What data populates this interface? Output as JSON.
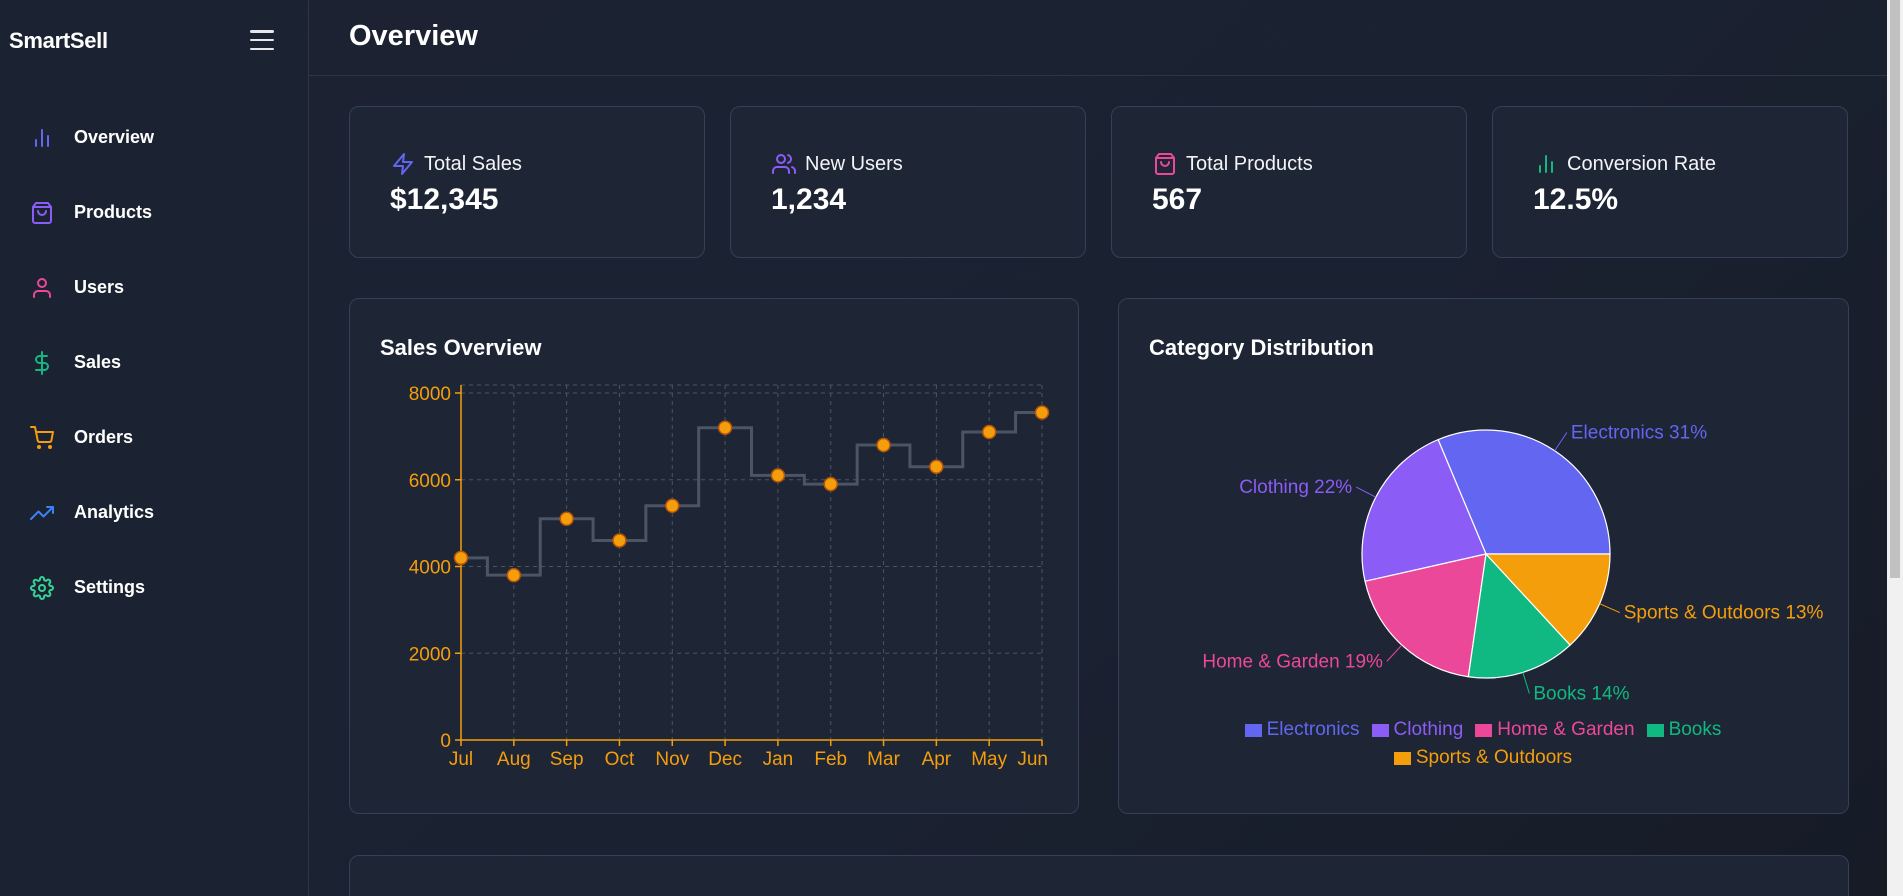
{
  "app": {
    "brand": "SmartSell"
  },
  "header": {
    "title": "Overview"
  },
  "sidebar": {
    "items": [
      {
        "label": "Overview",
        "icon": "bar-chart-icon",
        "color": "#6366f1"
      },
      {
        "label": "Products",
        "icon": "shopping-bag-icon",
        "color": "#8b5cf6"
      },
      {
        "label": "Users",
        "icon": "user-icon",
        "color": "#ec4899"
      },
      {
        "label": "Sales",
        "icon": "dollar-icon",
        "color": "#10b981"
      },
      {
        "label": "Orders",
        "icon": "cart-icon",
        "color": "#f59e0b"
      },
      {
        "label": "Analytics",
        "icon": "trending-up-icon",
        "color": "#3b82f6"
      },
      {
        "label": "Settings",
        "icon": "gear-icon",
        "color": "#34d399"
      }
    ]
  },
  "stats": [
    {
      "label": "Total Sales",
      "value": "$12,345",
      "icon": "zap-icon",
      "color": "#6366f1"
    },
    {
      "label": "New Users",
      "value": "1,234",
      "icon": "users-icon",
      "color": "#8b5cf6"
    },
    {
      "label": "Total Products",
      "value": "567",
      "icon": "shopping-bag-icon",
      "color": "#ec4899"
    },
    {
      "label": "Conversion Rate",
      "value": "12.5%",
      "icon": "bar-chart-icon",
      "color": "#10b981"
    }
  ],
  "sales_chart": {
    "title": "Sales Overview"
  },
  "pie_chart": {
    "title": "Category Distribution"
  },
  "colors": {
    "accent": "#f59e0b",
    "line": "#4b5563",
    "grid": "#4b5563"
  },
  "chart_data": [
    {
      "type": "line",
      "step": true,
      "categories": [
        "Jul",
        "Aug",
        "Sep",
        "Oct",
        "Nov",
        "Dec",
        "Jan",
        "Feb",
        "Mar",
        "Apr",
        "May",
        "Jun"
      ],
      "values": [
        4200,
        3800,
        5100,
        4600,
        5400,
        7200,
        6100,
        5900,
        6800,
        6300,
        7100,
        7550
      ],
      "ylim": [
        0,
        8000
      ],
      "yticks": [
        0,
        2000,
        4000,
        6000,
        8000
      ],
      "grid": true,
      "title": "Sales Overview"
    },
    {
      "type": "pie",
      "title": "Category Distribution",
      "slices": [
        {
          "label": "Electronics",
          "value": 31,
          "color": "#6366f1"
        },
        {
          "label": "Clothing",
          "value": 22,
          "color": "#8b5cf6"
        },
        {
          "label": "Home & Garden",
          "value": 19,
          "color": "#ec4899"
        },
        {
          "label": "Books",
          "value": 14,
          "color": "#10b981"
        },
        {
          "label": "Sports & Outdoors",
          "value": 13,
          "color": "#f59e0b"
        }
      ],
      "legend": "bottom"
    }
  ]
}
